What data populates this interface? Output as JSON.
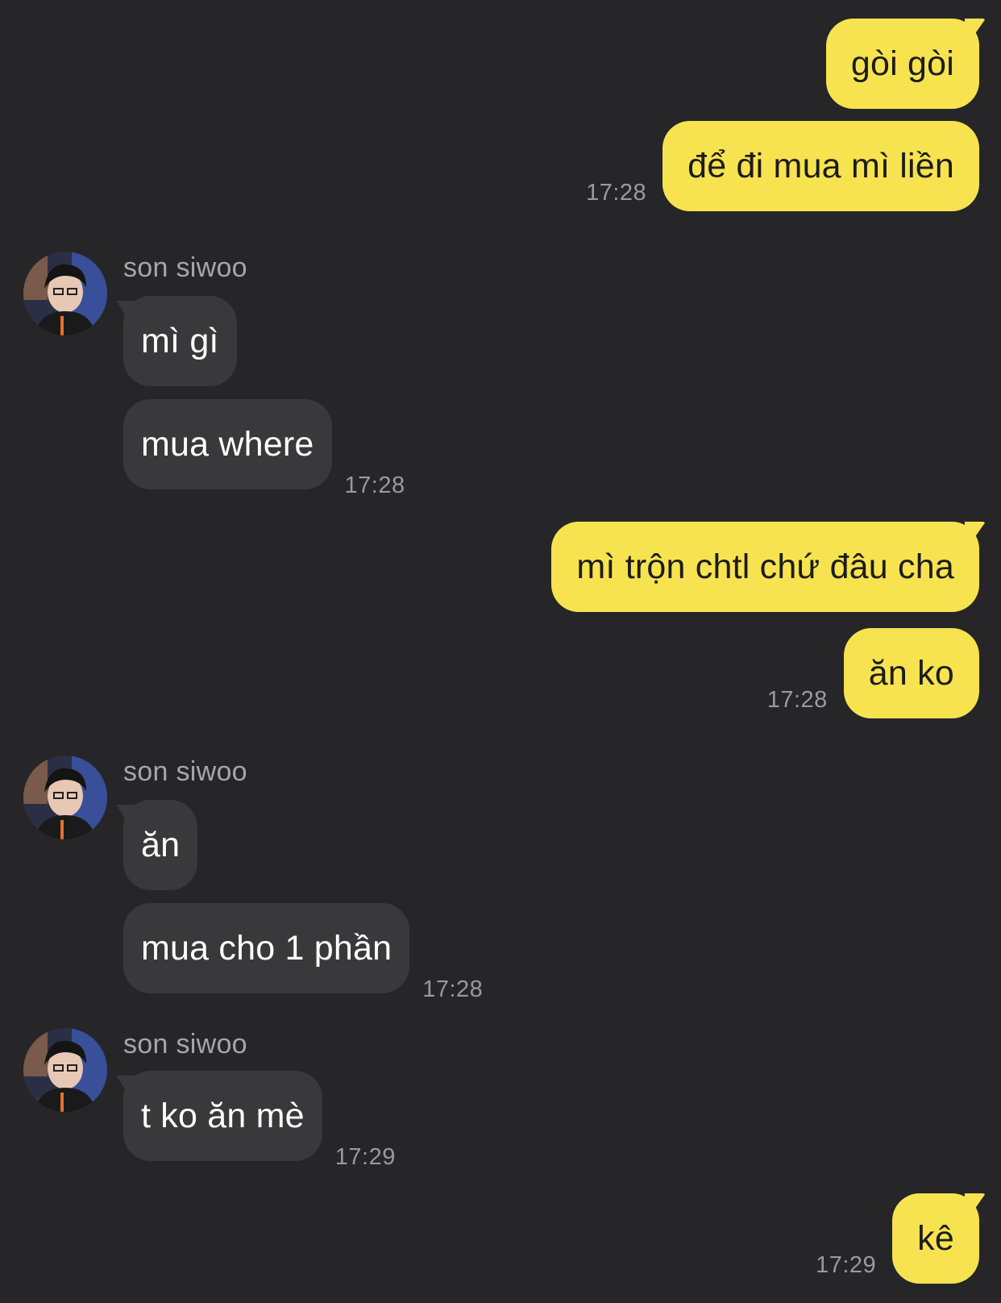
{
  "chat": {
    "contact_name": "son siwoo",
    "colors": {
      "background": "#262628",
      "my_bubble": "#f7e34f",
      "their_bubble": "#39393b",
      "timestamp": "#9a9a9c"
    },
    "messages": [
      {
        "from": "me",
        "text": "gòi gòi",
        "time": ""
      },
      {
        "from": "me",
        "text": "để đi mua mì liền",
        "time": "17:28"
      },
      {
        "from": "them",
        "sender": "son siwoo",
        "text": "mì gì",
        "time": ""
      },
      {
        "from": "them",
        "text": "mua where",
        "time": "17:28"
      },
      {
        "from": "me",
        "text": "mì trộn chtl chứ đâu cha",
        "time": ""
      },
      {
        "from": "me",
        "text": "ăn ko",
        "time": "17:28"
      },
      {
        "from": "them",
        "sender": "son siwoo",
        "text": "ăn",
        "time": ""
      },
      {
        "from": "them",
        "text": "mua cho 1 phần",
        "time": "17:28"
      },
      {
        "from": "them",
        "sender": "son siwoo",
        "text": "t ko ăn mè",
        "time": "17:29"
      },
      {
        "from": "me",
        "text": "kê",
        "time": "17:29"
      }
    ]
  }
}
